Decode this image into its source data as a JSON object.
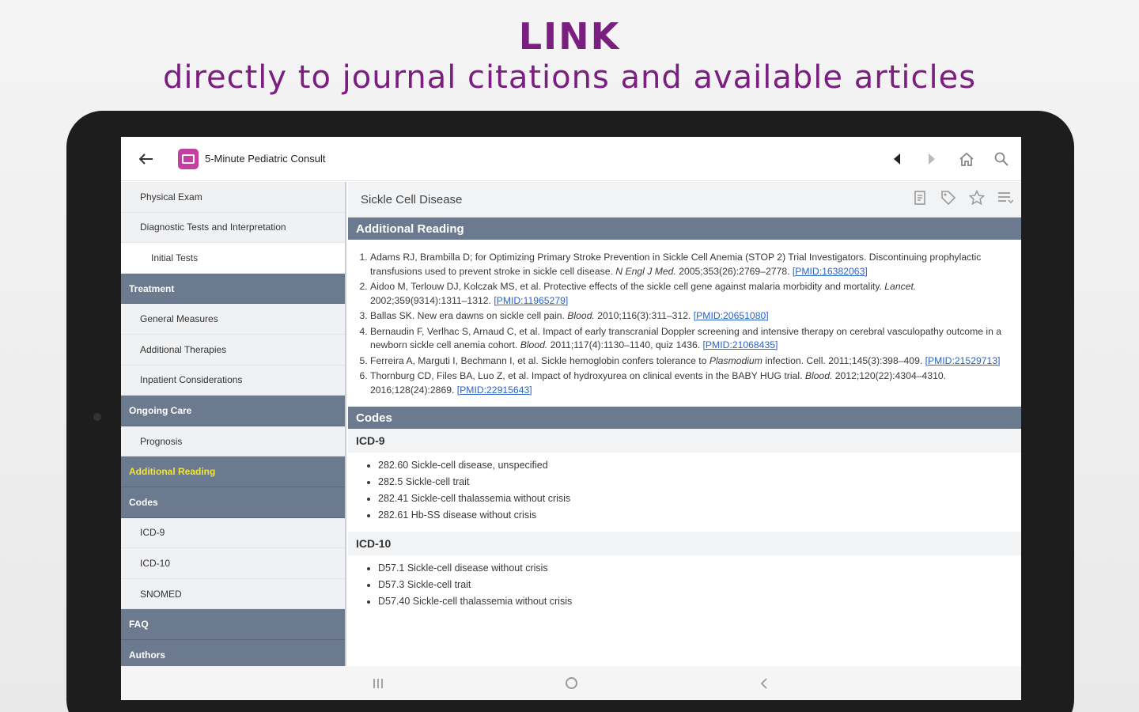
{
  "promo": {
    "headline": "LINK",
    "subheadline": "directly to journal citations and available articles"
  },
  "appbar": {
    "title": "5-Minute Pediatric Consult",
    "back_icon": "arrow-left-icon",
    "actions": [
      "triangle-left-icon",
      "triangle-right-icon",
      "home-icon",
      "search-icon"
    ]
  },
  "sidebar": {
    "items": [
      {
        "label": "Physical Exam",
        "level": "l2"
      },
      {
        "label": "Diagnostic Tests and Interpretation",
        "level": "l2"
      },
      {
        "label": "Initial Tests",
        "level": "l3"
      },
      {
        "label": "Treatment",
        "level": "section"
      },
      {
        "label": "General Measures",
        "level": "l2"
      },
      {
        "label": "Additional Therapies",
        "level": "l2"
      },
      {
        "label": "Inpatient Considerations",
        "level": "l2"
      },
      {
        "label": "Ongoing Care",
        "level": "section"
      },
      {
        "label": "Prognosis",
        "level": "l2"
      },
      {
        "label": "Additional Reading",
        "level": "section",
        "active": true
      },
      {
        "label": "Codes",
        "level": "section"
      },
      {
        "label": "ICD-9",
        "level": "l2"
      },
      {
        "label": "ICD-10",
        "level": "l2"
      },
      {
        "label": "SNOMED",
        "level": "l2"
      },
      {
        "label": "FAQ",
        "level": "section"
      },
      {
        "label": "Authors",
        "level": "section"
      }
    ],
    "active_color": "#f2e53a",
    "section_color": "#6b7a8f"
  },
  "main": {
    "topic_title": "Sickle Cell Disease",
    "topic_icons": [
      "notes-icon",
      "tag-icon",
      "star-icon",
      "list-icon"
    ],
    "additional_reading": {
      "heading": "Additional Reading",
      "refs": [
        {
          "text": "Adams RJ, Brambilla D; for Optimizing Primary Stroke Prevention in Sickle Cell Anemia (STOP 2) Trial Investigators. Discontinuing prophylactic transfusions used to prevent stroke in sickle cell disease. ",
          "journal": "N Engl J Med.",
          "cite": " 2005;353(26):2769–2778. ",
          "pmid": "[PMID:16382063]"
        },
        {
          "text": "Aidoo M, Terlouw DJ, Kolczak MS, et al. Protective effects of the sickle cell gene against malaria morbidity and mortality. ",
          "journal": "Lancet.",
          "cite": " 2002;359(9314):1311–1312. ",
          "pmid": "[PMID:11965279]"
        },
        {
          "text": "Ballas SK. New era dawns on sickle cell pain. ",
          "journal": "Blood.",
          "cite": " 2010;116(3):311–312. ",
          "pmid": "[PMID:20651080]"
        },
        {
          "text": "Bernaudin F, Verlhac S, Arnaud C, et al. Impact of early transcranial Doppler screening and intensive therapy on cerebral vasculopathy outcome in a newborn sickle cell anemia cohort. ",
          "journal": "Blood.",
          "cite": " 2011;117(4):1130–1140, quiz 1436. ",
          "pmid": "[PMID:21068435]"
        },
        {
          "text": "Ferreira A, Marguti I, Bechmann I, et al. Sickle hemoglobin confers tolerance to ",
          "journal": "Plasmodium",
          "cite": " infection. Cell. 2011;145(3):398–409. ",
          "pmid": "[PMID:21529713]"
        },
        {
          "text": "Thornburg CD, Files BA, Luo Z, et al. Impact of hydroxyurea on clinical events in the BABY HUG trial. ",
          "journal": "Blood.",
          "cite": " 2012;120(22):4304–4310. 2016;128(24):2869. ",
          "pmid": "[PMID:22915643]"
        }
      ]
    },
    "codes": {
      "heading": "Codes",
      "icd9_heading": "ICD-9",
      "icd9": [
        "282.60 Sickle-cell disease, unspecified",
        "282.5 Sickle-cell trait",
        "282.41 Sickle-cell thalassemia without crisis",
        "282.61 Hb-SS disease without crisis"
      ],
      "icd10_heading": "ICD-10",
      "icd10": [
        "D57.1 Sickle-cell disease without crisis",
        "D57.3 Sickle-cell trait",
        "D57.40 Sickle-cell thalassemia without crisis"
      ]
    }
  },
  "navbar": {
    "icons": [
      "recents-icon",
      "home-circle-icon",
      "back-chevron-icon"
    ]
  }
}
